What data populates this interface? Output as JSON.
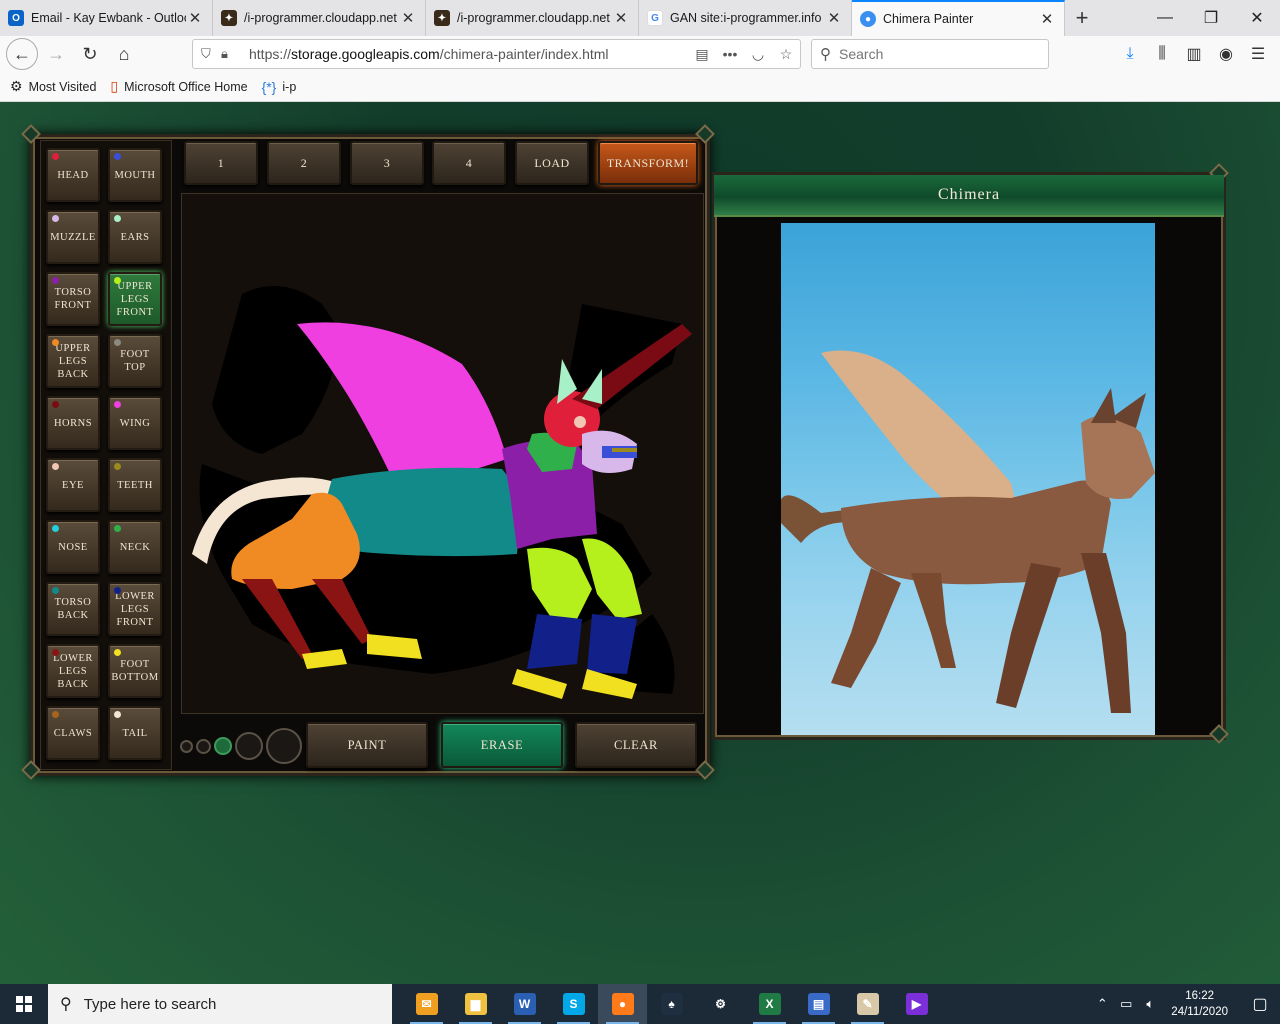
{
  "browser": {
    "tabs": [
      {
        "title": "Email - Kay Ewbank - Outlook",
        "favicon": "outlook-icon",
        "active": false
      },
      {
        "title": "/i-programmer.cloudapp.net",
        "favicon": "cloudapp-icon",
        "active": false
      },
      {
        "title": "/i-programmer.cloudapp.net",
        "favicon": "cloudapp-icon",
        "active": false
      },
      {
        "title": "GAN site:i-programmer.info",
        "favicon": "google-icon",
        "active": false
      },
      {
        "title": "Chimera Painter",
        "favicon": "chimera-icon",
        "active": true
      }
    ],
    "url_prefix": "https://",
    "url_domain": "storage.googleapis.com",
    "url_path": "/chimera-painter/index.html",
    "search_placeholder": "Search",
    "bookmarks": [
      {
        "label": "Most Visited",
        "icon": "gear-icon"
      },
      {
        "label": "Microsoft Office Home",
        "icon": "office-icon"
      },
      {
        "label": "i-p",
        "icon": "code-icon"
      }
    ]
  },
  "app": {
    "label_buttons": [
      {
        "label": "Head",
        "color": "#e0203a"
      },
      {
        "label": "Mouth",
        "color": "#3a4fd8"
      },
      {
        "label": "Muzzle",
        "color": "#d8b8ea"
      },
      {
        "label": "Ears",
        "color": "#a8f0c8"
      },
      {
        "label": "Torso Front",
        "color": "#8c1fa8"
      },
      {
        "label": "Upper Legs Front",
        "color": "#b6f01c",
        "selected": true
      },
      {
        "label": "Upper Legs Back",
        "color": "#f08a22"
      },
      {
        "label": "Foot Top",
        "color": "#8a8a80"
      },
      {
        "label": "Horns",
        "color": "#7a0b14"
      },
      {
        "label": "Wing",
        "color": "#ef3fe0"
      },
      {
        "label": "Eye",
        "color": "#f2c6b4"
      },
      {
        "label": "Teeth",
        "color": "#9a8a20"
      },
      {
        "label": "Nose",
        "color": "#22d0e0"
      },
      {
        "label": "Neck",
        "color": "#2fb04a"
      },
      {
        "label": "Torso Back",
        "color": "#138a8a"
      },
      {
        "label": "Lower Legs Front",
        "color": "#12208a"
      },
      {
        "label": "Lower Legs Back",
        "color": "#8a1414"
      },
      {
        "label": "Foot Bottom",
        "color": "#f0e020"
      },
      {
        "label": "Claws",
        "color": "#a8641c"
      },
      {
        "label": "Tail",
        "color": "#f4e6d2"
      }
    ],
    "top_buttons": [
      "1",
      "2",
      "3",
      "4",
      "Load",
      "Transform!"
    ],
    "bottom_buttons": [
      {
        "label": "Paint",
        "selected": false
      },
      {
        "label": "Erase",
        "selected": true
      },
      {
        "label": "Clear",
        "selected": false
      }
    ],
    "output_title": "Chimera"
  },
  "taskbar": {
    "search_placeholder": "Type here to search",
    "apps": [
      {
        "name": "outlook-app-icon",
        "color": "#f0a020",
        "glyph": "✉"
      },
      {
        "name": "file-explorer-icon",
        "color": "#f0c040",
        "glyph": "▆"
      },
      {
        "name": "word-icon",
        "color": "#2b5fb4",
        "glyph": "W"
      },
      {
        "name": "skype-icon",
        "color": "#00a8e8",
        "glyph": "S"
      },
      {
        "name": "firefox-icon",
        "color": "#ff7a18",
        "glyph": "●"
      },
      {
        "name": "solitaire-icon",
        "color": "#1f2f40",
        "glyph": "♠"
      },
      {
        "name": "settings-icon",
        "color": "#1c2a38",
        "glyph": "⚙"
      },
      {
        "name": "excel-icon",
        "color": "#1f7a44",
        "glyph": "X"
      },
      {
        "name": "notepad-icon",
        "color": "#3a6ac8",
        "glyph": "▤"
      },
      {
        "name": "paint-icon",
        "color": "#d8c8a8",
        "glyph": "✎"
      },
      {
        "name": "purple-app-icon",
        "color": "#7a2fd8",
        "glyph": "▶"
      }
    ],
    "time": "16:22",
    "date": "24/11/2020"
  }
}
